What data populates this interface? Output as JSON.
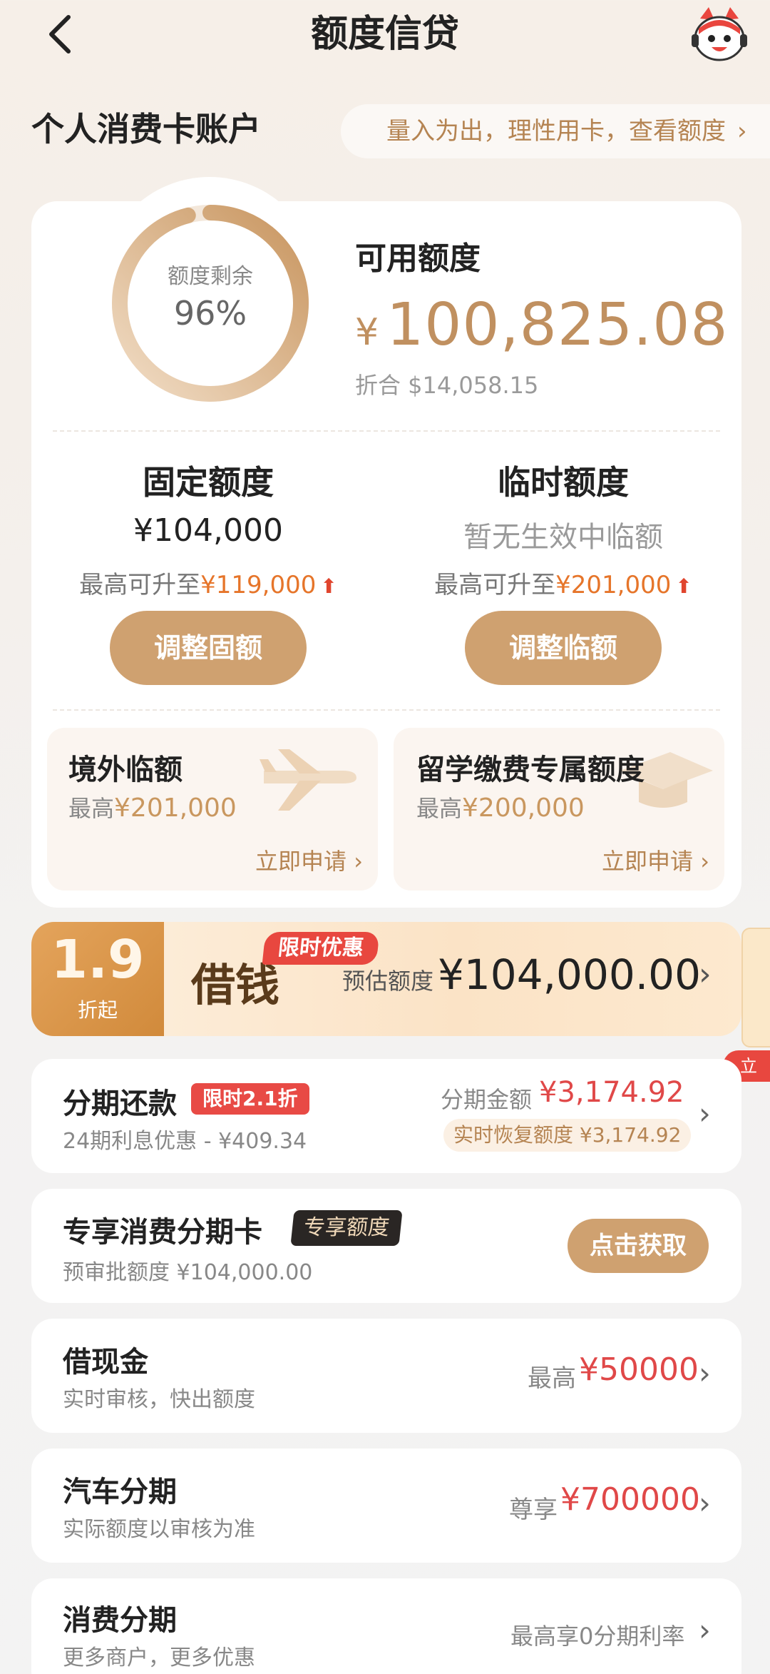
{
  "header": {
    "title": "额度信贷"
  },
  "account": {
    "section_title": "个人消费卡账户",
    "slogan": "量入为出，理性用卡，查看额度"
  },
  "summary": {
    "ring_label": "额度剩余",
    "ring_value": "96%",
    "remaining_fraction": 0.96,
    "available_label": "可用额度",
    "currency": "¥",
    "available_amount": "100,825.08",
    "equivalent": "折合 $14,058.15"
  },
  "fixed": {
    "title": "固定额度",
    "value": "¥104,000",
    "up_prefix": "最高可升至",
    "up_value": "¥119,000",
    "button": "调整固额"
  },
  "temporary": {
    "title": "临时额度",
    "value": "暂无生效中临额",
    "up_prefix": "最高可升至",
    "up_value": "¥201,000",
    "button": "调整临额"
  },
  "tiles": [
    {
      "title": "境外临额",
      "sub_prefix": "最高",
      "amount": "¥201,000",
      "link": "立即申请"
    },
    {
      "title": "留学缴费专属额度",
      "sub_prefix": "最高",
      "amount": "¥200,000",
      "link": "立即申请"
    }
  ],
  "banner": {
    "rate": "1.9",
    "rate_sub": "折起",
    "badge": "限时优惠",
    "title": "借钱",
    "est_label": "预估额度",
    "est_value": "¥104,000.00",
    "side_pill": "立"
  },
  "rows": {
    "installment": {
      "title": "分期还款",
      "tag": "限时2.1折",
      "sub": "24期利息优惠 - ¥409.34",
      "right_label": "分期金额",
      "right_value": "¥3,174.92",
      "recover": "实时恢复额度 ¥3,174.92"
    },
    "exclusive": {
      "title": "专享消费分期卡",
      "tag": "专享额度",
      "sub": "预审批额度 ¥104,000.00",
      "button": "点击获取"
    },
    "cash": {
      "title": "借现金",
      "sub": "实时审核，快出额度",
      "right_label": "最高",
      "right_value": "¥50000"
    },
    "car": {
      "title": "汽车分期",
      "sub": "实际额度以审核为准",
      "right_label": "尊享",
      "right_value": "¥700000"
    },
    "consumer": {
      "title": "消费分期",
      "sub": "更多商户，更多优惠",
      "right_label": "最高享0分期利率"
    }
  },
  "colors": {
    "accent_gold": "#cfa170",
    "amount_gold": "#c09060",
    "red": "#e04848",
    "orange": "#e6752a"
  }
}
